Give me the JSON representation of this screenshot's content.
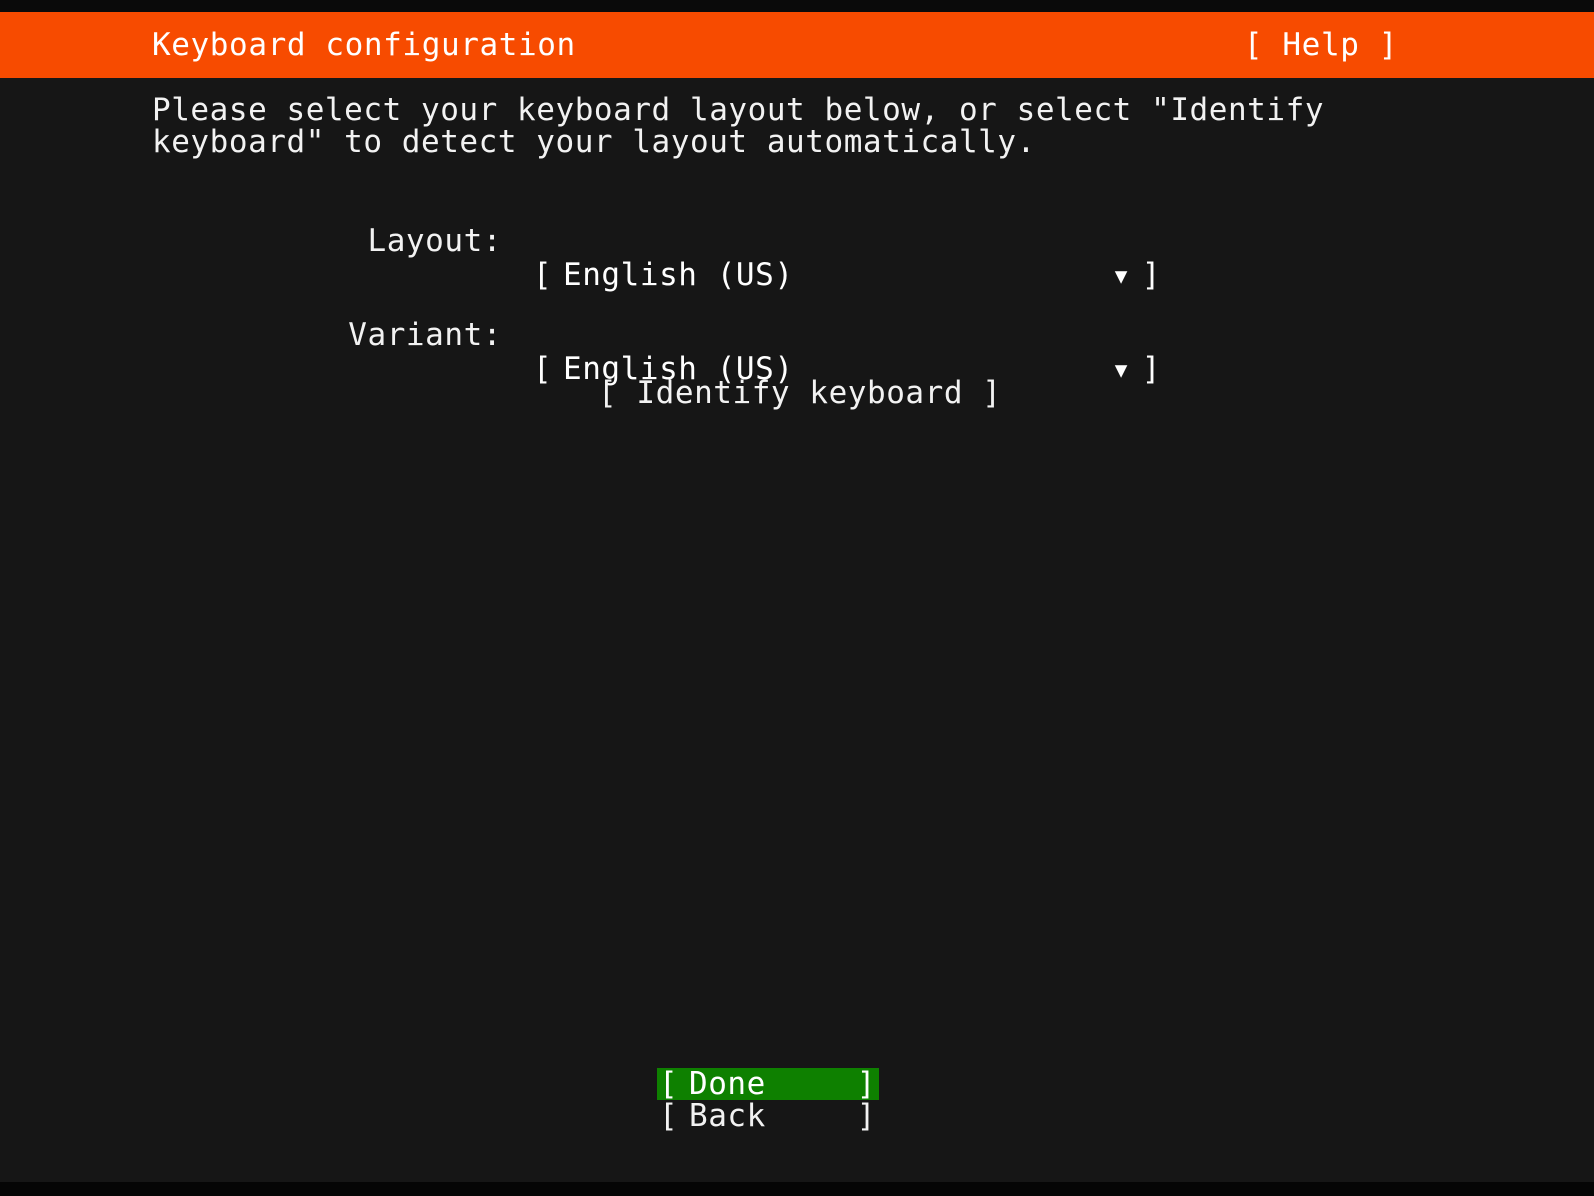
{
  "screen": {
    "background_color": "#161616",
    "foreground_color": "#ffffff"
  },
  "header": {
    "title": "Keyboard configuration",
    "accent_color": "#f74b00",
    "help_label": "[ Help ]"
  },
  "main": {
    "intro_text": "Please select your keyboard layout below, or select \"Identify keyboard\" to detect your layout automatically.",
    "fields": [
      {
        "label": "Layout:",
        "open_bracket": "[",
        "value": "English (US)",
        "caret": "▼",
        "close_bracket": "]"
      },
      {
        "label": "Variant:",
        "open_bracket": "[",
        "value": "English (US)",
        "caret": "▼",
        "close_bracket": "]"
      }
    ],
    "identify_button": "[ Identify keyboard ]"
  },
  "footer": {
    "highlight_color": "#0e8000",
    "buttons": [
      {
        "bracket_left": "[",
        "label": "Done",
        "bracket_right": "]",
        "selected": true
      },
      {
        "bracket_left": "[",
        "label": "Back",
        "bracket_right": "]",
        "selected": false
      }
    ]
  }
}
